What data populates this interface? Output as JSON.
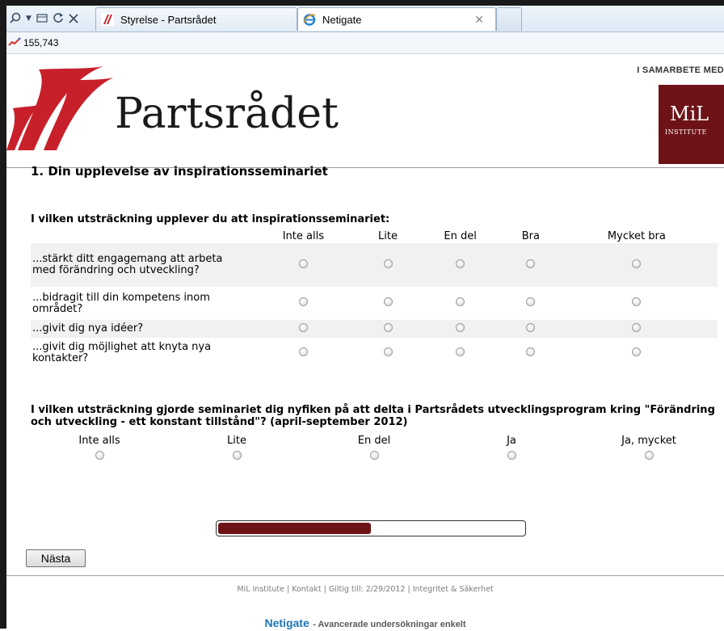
{
  "browser": {
    "tabs": [
      {
        "title": "Styrelse - Partsrådet",
        "active": false
      },
      {
        "title": "Netigate",
        "active": true
      }
    ],
    "favorites": {
      "counter": "155,743"
    }
  },
  "header": {
    "brand": "Partsrådet",
    "partner_label": "I SAMARBETE MED",
    "partner_logo_name": "MiL",
    "partner_logo_sub": "INSTITUTE",
    "colors": {
      "brand_red": "#c8202a",
      "mil_bg": "#6d1317"
    }
  },
  "survey": {
    "section_title": "1. Din upplevelse av inspirationsseminariet",
    "q1": {
      "text": "I vilken utsträckning upplever du att inspirationsseminariet:",
      "columns": [
        "Inte alls",
        "Lite",
        "En del",
        "Bra",
        "Mycket bra"
      ],
      "rows": [
        "...stärkt ditt engagemang att arbeta med förändring och utveckling?",
        "...bidragit till din kompetens inom området?",
        "...givit dig nya idéer?",
        "...givit dig möjlighet att knyta nya kontakter?"
      ]
    },
    "q2": {
      "text": "I vilken utsträckning gjorde seminariet dig nyfiken på att delta i Partsrådets utvecklingsprogram kring \"Förändring och utveckling - ett konstant tillstånd\"? (april-september 2012)",
      "options": [
        "Inte alls",
        "Lite",
        "En del",
        "Ja",
        "Ja, mycket"
      ]
    },
    "progress": 0.5,
    "next_label": "Nästa"
  },
  "footer": {
    "links": [
      "MiL Institute",
      "Kontakt",
      "Giltig till: 2/29/2012",
      "Integritet & Säkerhet"
    ],
    "brand": "Netigate",
    "tagline": "- Avancerade undersökningar enkelt",
    "brand_color": "#1e74b8"
  }
}
